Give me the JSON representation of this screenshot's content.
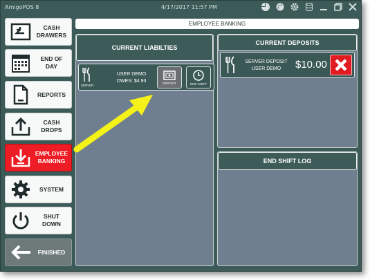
{
  "titlebar": {
    "app_name": "AmigoPOS 8",
    "datetime": "4/17/2017 11:57 PM",
    "icons": [
      "pie-chart-icon",
      "palette-icon",
      "gear-icon",
      "database-icon",
      "minimize-icon",
      "restore-icon",
      "close-icon"
    ]
  },
  "sidebar": {
    "items": [
      {
        "line1": "CASH",
        "line2": "DRAWERS",
        "icon": "cash-drawer-icon"
      },
      {
        "line1": "END OF",
        "line2": "DAY",
        "icon": "calendar-icon"
      },
      {
        "line1": "REPORTS",
        "line2": "",
        "icon": "document-icon"
      },
      {
        "line1": "CASH",
        "line2": "DROPS",
        "icon": "upload-tray-icon"
      },
      {
        "line1": "EMPLOYEE",
        "line2": "BANKING",
        "icon": "download-tray-icon"
      },
      {
        "line1": "SYSTEM",
        "line2": "",
        "icon": "gear-icon"
      },
      {
        "line1": "SHUT",
        "line2": "DOWN",
        "icon": "power-icon"
      },
      {
        "line1": "FINISHED",
        "line2": "",
        "icon": "arrow-left-icon"
      }
    ]
  },
  "header": {
    "title": "EMPLOYEE BANKING"
  },
  "liabilities": {
    "title": "CURRENT LIABILTIES",
    "card": {
      "server_label": "SERVER",
      "name": "USER DEMO",
      "owes": "OWES:  $4.93",
      "deposit_label": "DEPOSIT",
      "end_shift_label": "END SHIFT"
    }
  },
  "deposits": {
    "title": "CURRENT DEPOSITS",
    "card": {
      "line1": "SERVER DEPOSIT",
      "line2": "USER DEMO",
      "amount": "$10.00"
    }
  },
  "end_shift_log": {
    "title": "END SHIFT LOG"
  },
  "colors": {
    "background": "#3b5a58",
    "panel": "#6f7f8f",
    "active": "#ee1c24",
    "arrow": "#f5f21a"
  }
}
